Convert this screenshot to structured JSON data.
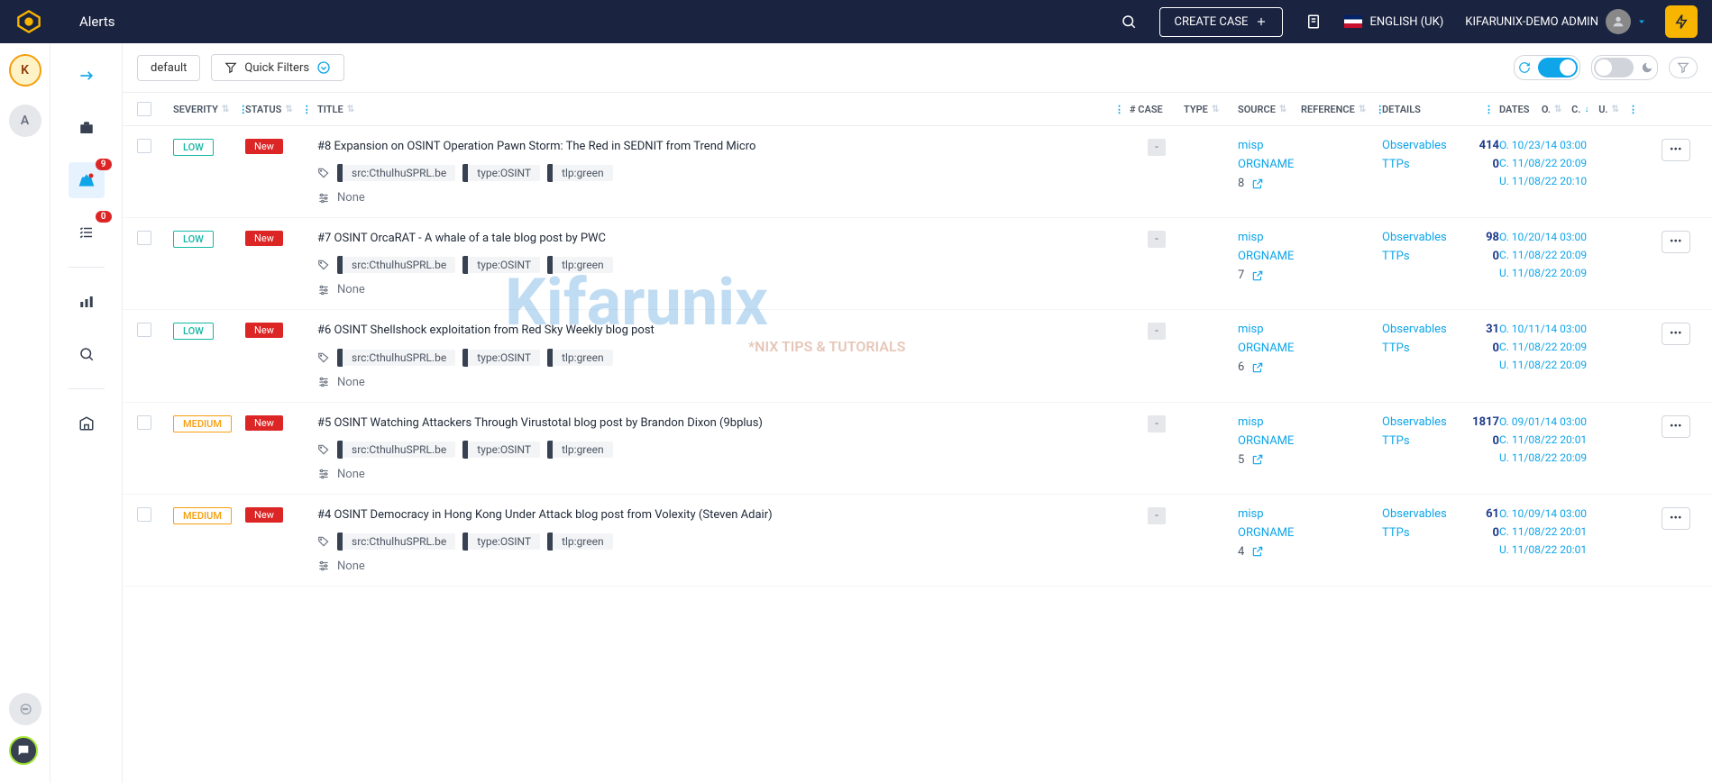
{
  "topbar": {
    "title": "Alerts",
    "create_case": "CREATE CASE",
    "language": "ENGLISH (UK)",
    "user": "KIFARUNIX-DEMO ADMIN"
  },
  "rail1": {
    "avatar1": "K",
    "avatar2": "A"
  },
  "rail2": {
    "badge_alerts": "9",
    "badge_tasks": "0"
  },
  "filters": {
    "default": "default",
    "quick": "Quick Filters"
  },
  "headers": {
    "severity": "SEVERITY",
    "status": "STATUS",
    "title": "TITLE",
    "case": "# CASE",
    "type": "TYPE",
    "source": "SOURCE",
    "reference": "REFERENCE",
    "details": "DETAILS",
    "dates": "DATES",
    "o": "O.",
    "c": "C.",
    "u": "U."
  },
  "labels": {
    "observables": "Observables",
    "ttps": "TTPs",
    "none": "None",
    "orgname": "ORGNAME",
    "misp": "misp"
  },
  "tags": {
    "src": "src:CthulhuSPRL.be",
    "type": "type:OSINT",
    "tlp": "tlp:green"
  },
  "rows": [
    {
      "severity": "LOW",
      "sev_class": "sev-low",
      "status": "New",
      "title": "#8 Expansion on OSINT Operation Pawn Storm: The Red in SEDNIT from Trend Micro",
      "case": "-",
      "ref_num": "8",
      "obs": "414",
      "ttps": "0",
      "date_o": "O. 10/23/14 03:00",
      "date_c": "C. 11/08/22 20:09",
      "date_u": "U. 11/08/22 20:10"
    },
    {
      "severity": "LOW",
      "sev_class": "sev-low",
      "status": "New",
      "title": "#7 OSINT OrcaRAT - A whale of a tale blog post by PWC",
      "case": "-",
      "ref_num": "7",
      "obs": "98",
      "ttps": "0",
      "date_o": "O. 10/20/14 03:00",
      "date_c": "C. 11/08/22 20:09",
      "date_u": "U. 11/08/22 20:09"
    },
    {
      "severity": "LOW",
      "sev_class": "sev-low",
      "status": "New",
      "title": "#6 OSINT Shellshock exploitation from Red Sky Weekly blog post",
      "case": "-",
      "ref_num": "6",
      "obs": "31",
      "ttps": "0",
      "date_o": "O. 10/11/14 03:00",
      "date_c": "C. 11/08/22 20:09",
      "date_u": "U. 11/08/22 20:09"
    },
    {
      "severity": "MEDIUM",
      "sev_class": "sev-medium",
      "status": "New",
      "title": "#5 OSINT Watching Attackers Through Virustotal blog post by Brandon Dixon (9bplus)",
      "case": "-",
      "ref_num": "5",
      "obs": "1817",
      "ttps": "0",
      "date_o": "O. 09/01/14 03:00",
      "date_c": "C. 11/08/22 20:01",
      "date_u": "U. 11/08/22 20:09"
    },
    {
      "severity": "MEDIUM",
      "sev_class": "sev-medium",
      "status": "New",
      "title": "#4 OSINT Democracy in Hong Kong Under Attack blog post from Volexity (Steven Adair)",
      "case": "-",
      "ref_num": "4",
      "obs": "61",
      "ttps": "0",
      "date_o": "O. 10/09/14 03:00",
      "date_c": "C. 11/08/22 20:01",
      "date_u": "U. 11/08/22 20:01"
    }
  ],
  "watermark": {
    "brand": "Kifarunix",
    "tagline": "*NIX TIPS & TUTORIALS"
  }
}
